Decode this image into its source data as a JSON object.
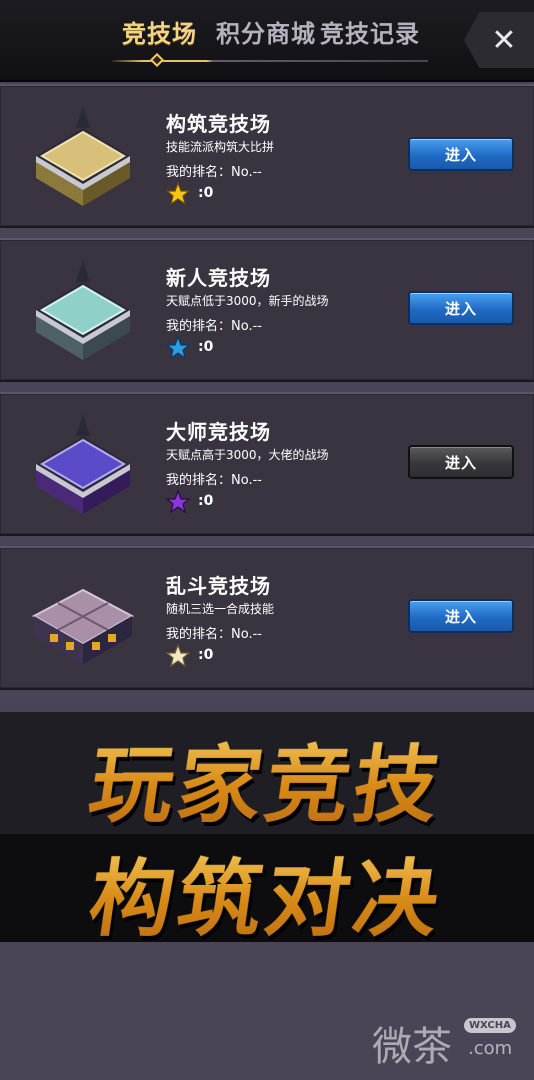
{
  "header": {
    "tabs": [
      {
        "label": "竞技场",
        "active": true
      },
      {
        "label": "积分商城",
        "active": false
      },
      {
        "label": "竞技记录",
        "active": false
      }
    ],
    "close_label": "✕"
  },
  "arenas": [
    {
      "title": "构筑竞技场",
      "desc": "技能流派构筑大比拼",
      "rank_label": "我的排名：",
      "rank_value": "No.--",
      "score": ":0",
      "star_color": "#f5c518",
      "button": "进入",
      "button_state": "enabled",
      "icon_color": "#d9c07a"
    },
    {
      "title": "新人竞技场",
      "desc": "天赋点低于3000，新手的战场",
      "rank_label": "我的排名：",
      "rank_value": "No.--",
      "score": ":0",
      "star_color": "#2b9fe6",
      "button": "进入",
      "button_state": "enabled",
      "icon_color": "#8fd0c8"
    },
    {
      "title": "大师竞技场",
      "desc": "天赋点高于3000，大佬的战场",
      "rank_label": "我的排名：",
      "rank_value": "No.--",
      "score": ":0",
      "star_color": "#8a36d8",
      "button": "进入",
      "button_state": "disabled",
      "icon_color": "#5a4cc8"
    },
    {
      "title": "乱斗竞技场",
      "desc": "随机三选一合成技能",
      "rank_label": "我的排名：",
      "rank_value": "No.--",
      "score": ":0",
      "star_color": "#f3e6c0",
      "button": "进入",
      "button_state": "enabled",
      "icon_color": "#a98fa8"
    }
  ],
  "banner": {
    "line1": "玩家竞技",
    "line2": "构筑对决"
  },
  "watermark": {
    "text": "微茶",
    "badge": "WXCHA",
    "domain": ".com"
  }
}
